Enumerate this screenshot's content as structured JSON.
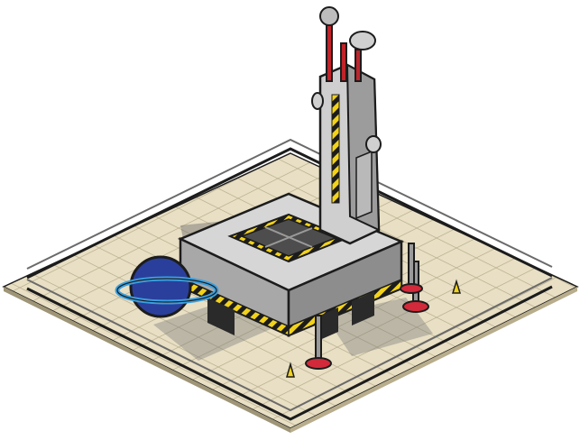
{
  "scene": {
    "description_name": "isometric-space-launch-base",
    "colors": {
      "background": "#ffffff",
      "tile": "#e8dfc4",
      "tile_line": "#b8ad8c",
      "concrete": "#c9c9c9",
      "concrete_dark": "#8d8d8d",
      "concrete_light": "#e4e4e4",
      "outline": "#1c1c1c",
      "hazard_yellow": "#f2d21a",
      "hazard_black": "#1c1c1c",
      "planet_blue": "#2a3f9c",
      "ring_cyan": "#3aa0e0",
      "pad_red": "#d22a3a",
      "antenna_red": "#c0242a",
      "rail": "#5a5a5a"
    },
    "icons": [
      "tower-antenna-icon",
      "satellite-dish-icon",
      "planet-sign-icon",
      "landing-leg-icon",
      "warning-cone-icon"
    ]
  }
}
